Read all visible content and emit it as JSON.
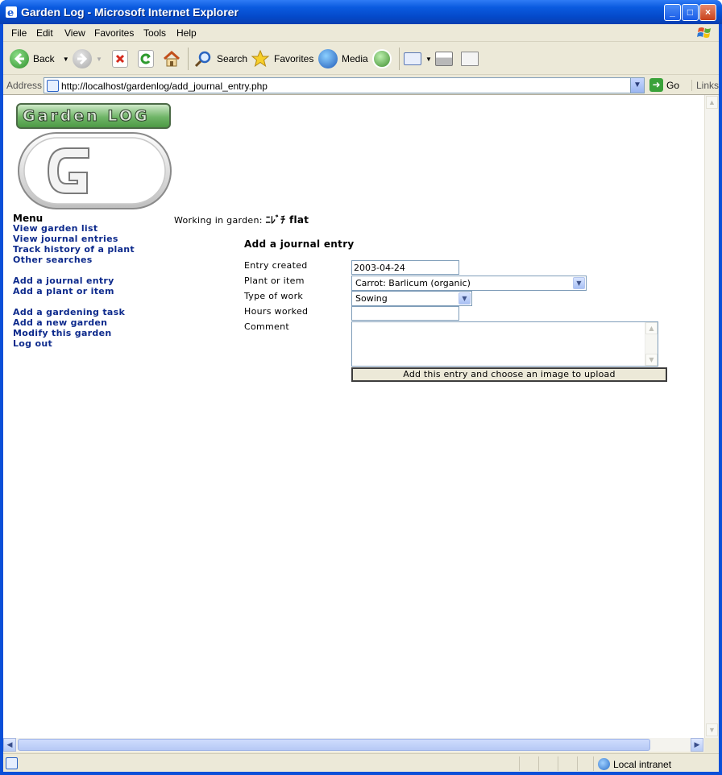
{
  "window": {
    "title": "Garden Log - Microsoft Internet Explorer"
  },
  "menubar": {
    "items": [
      "File",
      "Edit",
      "View",
      "Favorites",
      "Tools",
      "Help"
    ]
  },
  "toolbar": {
    "back": "Back",
    "search": "Search",
    "favorites": "Favorites",
    "media": "Media"
  },
  "address": {
    "label": "Address",
    "url": "http://localhost/gardenlog/add_journal_entry.php",
    "go": "Go",
    "links": "Links"
  },
  "page": {
    "logo_text": "Garden LOG",
    "menu": {
      "title": "Menu",
      "items": [
        "View garden list",
        "View journal entries",
        "Track history of a plant",
        "Other searches",
        "Add a journal entry",
        "Add a plant or item",
        "Add a gardening task",
        "Add a new garden",
        "Modify this garden",
        "Log out"
      ]
    },
    "working_label": "Working in garden:",
    "garden_name": "ﾆﾚﾞﾁ flat",
    "form": {
      "title": "Add a journal entry",
      "entry_created_label": "Entry created",
      "entry_created_value": "2003-04-24",
      "plant_label": "Plant or item",
      "plant_value": "Carrot: Barlicum (organic)",
      "type_label": "Type of work",
      "type_value": "Sowing",
      "hours_label": "Hours worked",
      "hours_value": "",
      "comment_label": "Comment",
      "submit_label": "Add this entry and choose an image to upload"
    }
  },
  "status": {
    "zone": "Local intranet"
  }
}
